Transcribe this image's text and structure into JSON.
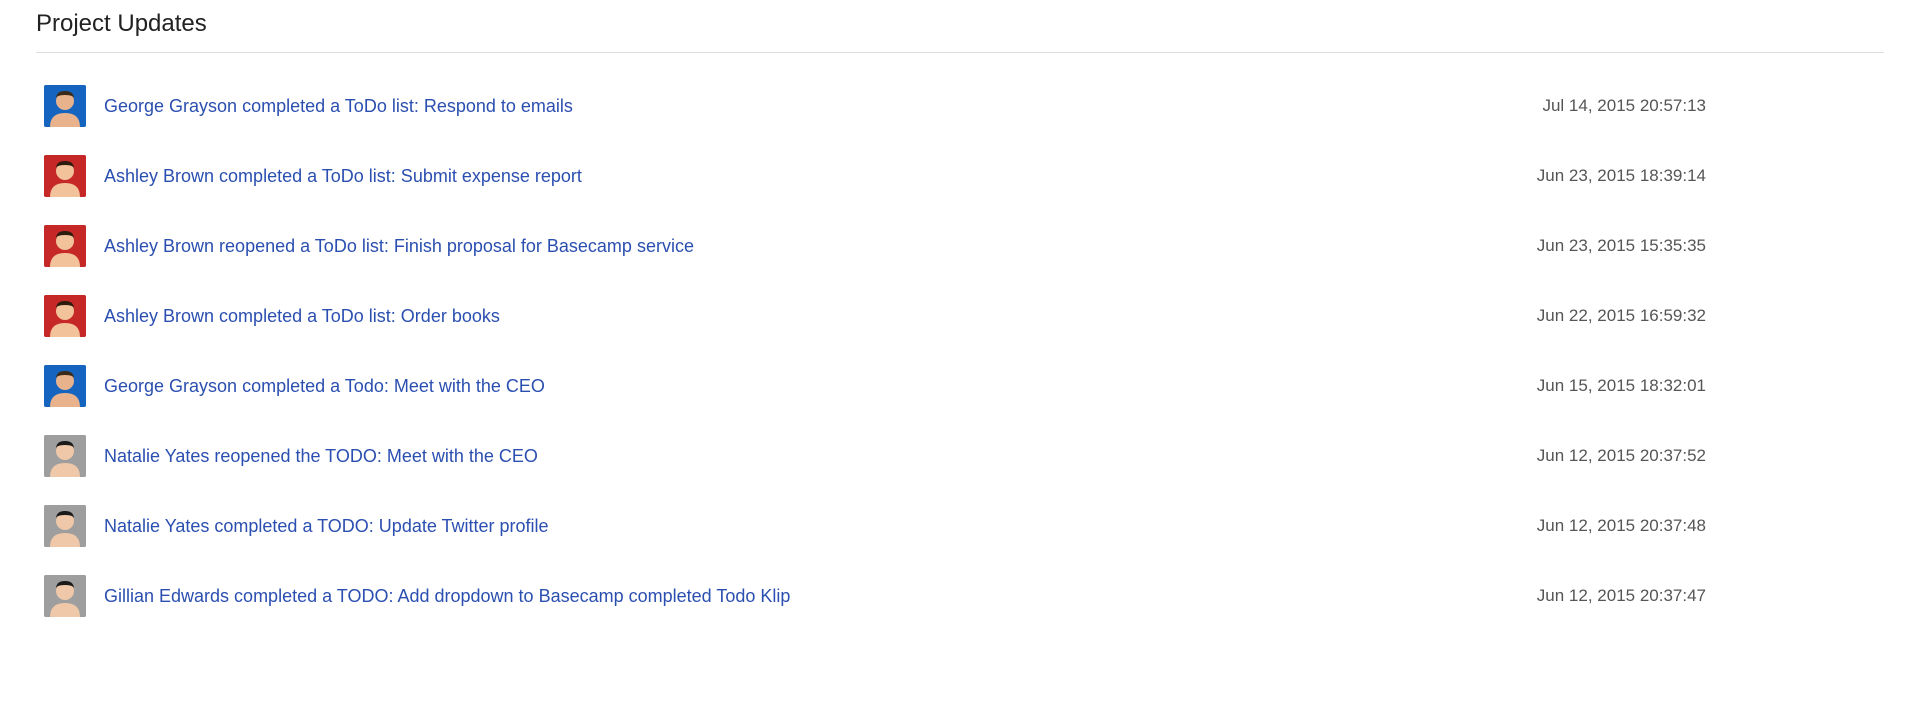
{
  "title": "Project Updates",
  "updates": [
    {
      "avatar_key": "george",
      "summary": "George Grayson completed a ToDo list: Respond to emails",
      "timestamp": "Jul 14, 2015 20:57:13"
    },
    {
      "avatar_key": "ashley",
      "summary": "Ashley Brown completed a ToDo list: Submit expense report",
      "timestamp": "Jun 23, 2015 18:39:14"
    },
    {
      "avatar_key": "ashley",
      "summary": "Ashley Brown reopened a ToDo list: Finish proposal for Basecamp service",
      "timestamp": "Jun 23, 2015 15:35:35"
    },
    {
      "avatar_key": "ashley",
      "summary": "Ashley Brown completed a ToDo list: Order books",
      "timestamp": "Jun 22, 2015 16:59:32"
    },
    {
      "avatar_key": "george",
      "summary": "George Grayson completed a Todo: Meet with the CEO",
      "timestamp": "Jun 15, 2015 18:32:01"
    },
    {
      "avatar_key": "natalie",
      "summary": "Natalie Yates reopened the TODO: Meet with the CEO",
      "timestamp": "Jun 12, 2015 20:37:52"
    },
    {
      "avatar_key": "natalie",
      "summary": "Natalie Yates completed a TODO: Update Twitter profile",
      "timestamp": "Jun 12, 2015 20:37:48"
    },
    {
      "avatar_key": "gillian",
      "summary": "Gillian Edwards completed a TODO: Add dropdown to Basecamp completed Todo Klip",
      "timestamp": "Jun 12, 2015 20:37:47"
    }
  ],
  "avatars": {
    "george": {
      "bg": "#1565c0",
      "skin": "#e8b38c",
      "hair": "#3b2a1a"
    },
    "ashley": {
      "bg": "#c62828",
      "skin": "#f2c29a",
      "hair": "#2d1b0e"
    },
    "natalie": {
      "bg": "#9e9e9e",
      "skin": "#eec8a8",
      "hair": "#1a1a1a"
    },
    "gillian": {
      "bg": "#9e9e9e",
      "skin": "#eec8a8",
      "hair": "#1a1a1a"
    }
  }
}
